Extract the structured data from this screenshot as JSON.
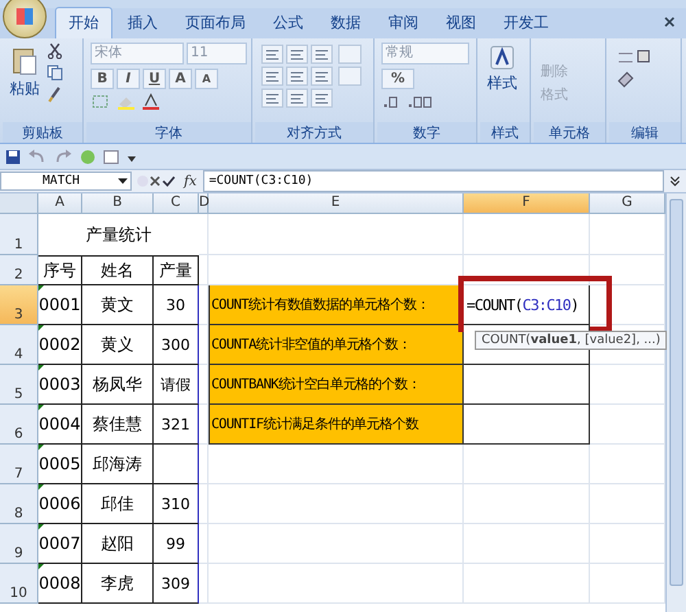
{
  "tabs": [
    {
      "label": "开始",
      "selected": true
    },
    {
      "label": "插入",
      "selected": false
    },
    {
      "label": "页面布局",
      "selected": false
    },
    {
      "label": "公式",
      "selected": false
    },
    {
      "label": "数据",
      "selected": false
    },
    {
      "label": "审阅",
      "selected": false
    },
    {
      "label": "视图",
      "selected": false
    },
    {
      "label": "开发工",
      "selected": false
    }
  ],
  "ribbon_groups": [
    {
      "kind": "clipboard",
      "label": "剪贴板",
      "paste": "粘贴"
    },
    {
      "kind": "font",
      "label": "字体",
      "font": "宋体",
      "size": "11",
      "format_buttons": [
        "B",
        "I",
        "U"
      ],
      "size_buttons": [
        "A",
        "A"
      ]
    },
    {
      "kind": "alignment",
      "label": "对齐方式"
    },
    {
      "kind": "number",
      "label": "数字",
      "format": "常规",
      "percent": "%"
    },
    {
      "kind": "styles",
      "label": "样式",
      "button": "样式"
    },
    {
      "kind": "cells",
      "label": "单元格",
      "buttons": [
        "删除",
        "格式"
      ]
    },
    {
      "kind": "editing",
      "label": "编辑"
    }
  ],
  "name_box": "MATCH",
  "function_button": "fx",
  "formula": "=COUNT(C3:C10)",
  "columns": [
    {
      "label": "A",
      "selected": false
    },
    {
      "label": "B",
      "selected": false
    },
    {
      "label": "C",
      "selected": false
    },
    {
      "label": "D",
      "selected": false
    },
    {
      "label": "E",
      "selected": false
    },
    {
      "label": "F",
      "selected": true
    },
    {
      "label": "G",
      "selected": false
    }
  ],
  "row_headers": [
    {
      "label": "1",
      "selected": false
    },
    {
      "label": "2",
      "selected": false
    },
    {
      "label": "3",
      "selected": true
    },
    {
      "label": "4",
      "selected": false
    },
    {
      "label": "5",
      "selected": false
    },
    {
      "label": "6",
      "selected": false
    },
    {
      "label": "7",
      "selected": false
    },
    {
      "label": "8",
      "selected": false
    },
    {
      "label": "9",
      "selected": false
    },
    {
      "label": "10",
      "selected": false
    }
  ],
  "sheet_title": "产量统计",
  "table_headers": [
    "序号",
    "姓名",
    "产量"
  ],
  "records": [
    {
      "id": "0001",
      "name": "黄文",
      "output": "30"
    },
    {
      "id": "0002",
      "name": "黄义",
      "output": "300"
    },
    {
      "id": "0003",
      "name": "杨凤华",
      "output": "请假"
    },
    {
      "id": "0004",
      "name": "蔡佳慧",
      "output": "321"
    },
    {
      "id": "0005",
      "name": "邱海涛"
    },
    {
      "id": "0006",
      "name": "邱佳",
      "output": "310"
    },
    {
      "id": "0007",
      "name": "赵阳",
      "output": "99"
    },
    {
      "id": "0008",
      "name": "李虎",
      "output": "309"
    }
  ],
  "count_items": [
    {
      "label": "COUNT统计有数值数据的单元格个数：",
      "editing": {
        "prefix": "=COUNT(",
        "reference": "C3:C10",
        "suffix": ")"
      }
    },
    {
      "label": "COUNTA统计非空值的单元格个数："
    },
    {
      "label": "COUNTBANK统计空白单元格的个数："
    },
    {
      "label": "COUNTIF统计满足条件的单元格个数"
    }
  ],
  "tooltip": "COUNT(**value1**, [value2], ...)"
}
